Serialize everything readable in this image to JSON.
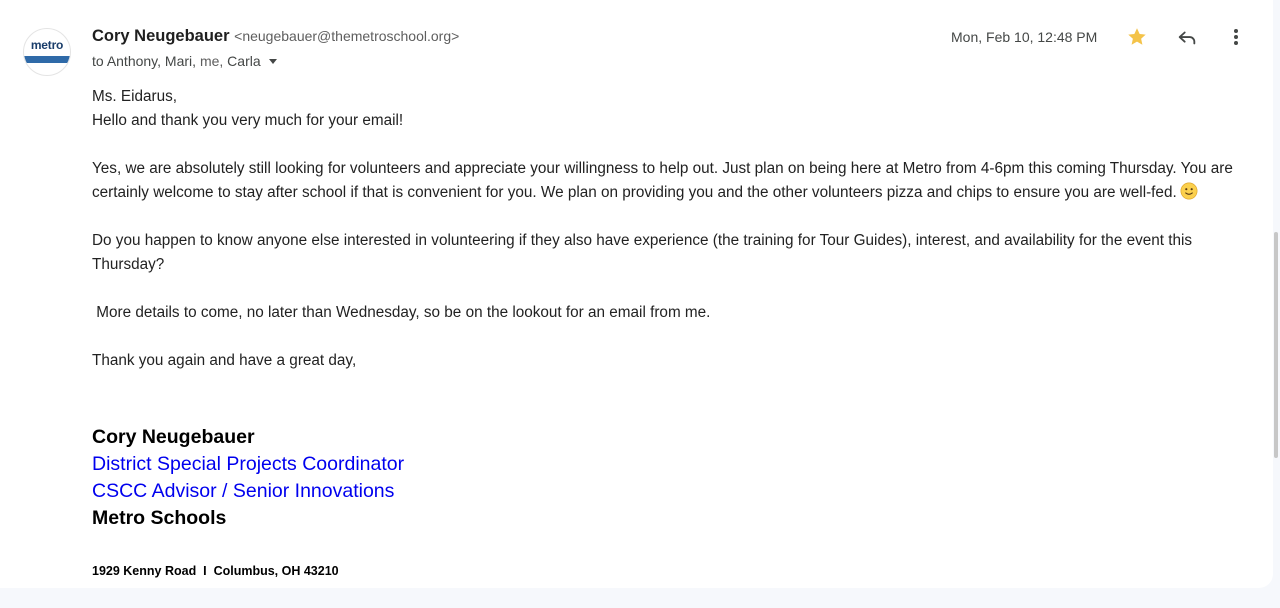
{
  "email": {
    "sender_name": "Cory Neugebauer",
    "sender_email": "<neugebauer@themetroschool.org>",
    "to_prefix": "to",
    "recipients_before_me": "Anthony, Mari,",
    "recipient_me": "me,",
    "recipients_after_me": "Carla",
    "date": "Mon, Feb 10, 12:48 PM",
    "avatar_logo_text": "metro",
    "starred": true
  },
  "body": {
    "greeting": "Ms. Eidarus,",
    "line1": "Hello and thank you very much for your email!",
    "para1": "Yes, we are absolutely still looking for volunteers and appreciate your willingness to help out. Just plan on being here at Metro from 4-6pm this coming Thursday. You are certainly welcome to stay after school if that is convenient for you. We plan on providing you and the other volunteers pizza and chips to ensure you are well-fed.",
    "para2": "Do you happen to know anyone else interested in volunteering if they also have experience (the training for Tour Guides), interest, and availability for the event this Thursday?",
    "para3": " More details to come, no later than Wednesday, so be on the lookout for an email from me.",
    "closing": "Thank you again and have a great day,"
  },
  "signature": {
    "name": "Cory Neugebauer",
    "title1": "District Special Projects Coordinator",
    "title2": "CSCC Advisor / Senior Innovations",
    "org": "Metro Schools",
    "address": "1929 Kenny Road  I  Columbus, OH 43210"
  },
  "icons": {
    "star": "star-icon",
    "reply": "reply-icon",
    "more": "more-vert-icon",
    "emoji": "slightly-smiling-face-icon"
  },
  "colors": {
    "star": "#f4c349",
    "link_blue": "#0000ee",
    "page_bg": "#f6f8fc"
  }
}
